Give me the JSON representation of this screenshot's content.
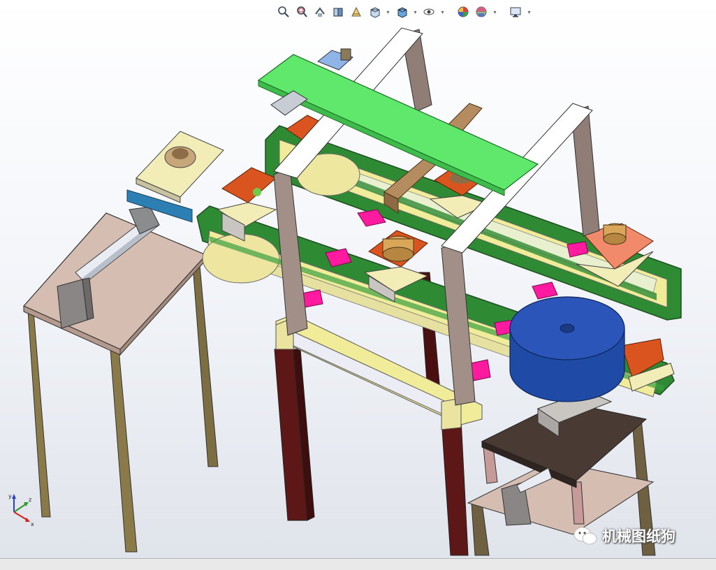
{
  "toolbar": {
    "items": [
      {
        "icon": "zoom-to-fit-icon"
      },
      {
        "icon": "zoom-to-area-icon"
      },
      {
        "icon": "previous-view-icon"
      },
      {
        "icon": "section-view-icon"
      },
      {
        "icon": "dynamic-annotation-view-icon"
      },
      {
        "icon": "view-orientation-icon",
        "dropdown": true
      },
      {
        "icon": "display-style-icon",
        "dropdown": true
      },
      {
        "icon": "hide-show-items-icon",
        "dropdown": true
      },
      {
        "icon": "edit-appearance-icon"
      },
      {
        "icon": "apply-scene-icon",
        "dropdown": true
      },
      {
        "icon": "view-settings-icon",
        "dropdown": true
      }
    ]
  },
  "triad": {
    "x_label": "x",
    "y_label": "y",
    "z_label": "z"
  },
  "watermark": {
    "text": "机械图纸狗"
  },
  "colors": {
    "background_top": "#ffffff",
    "background_bottom": "#dfe3ea",
    "top_plate": "#5fe86c",
    "conveyor_belt": "#2f8a34",
    "frame_yellow": "#f0ec9a",
    "uprights": "#a18f88",
    "legs_dark_red": "#5a1414",
    "fixture_orange": "#c8501e",
    "pink_plates": "#ff1aa0",
    "blue_drum": "#2b55b8",
    "table_top": "#d6bdb1"
  }
}
